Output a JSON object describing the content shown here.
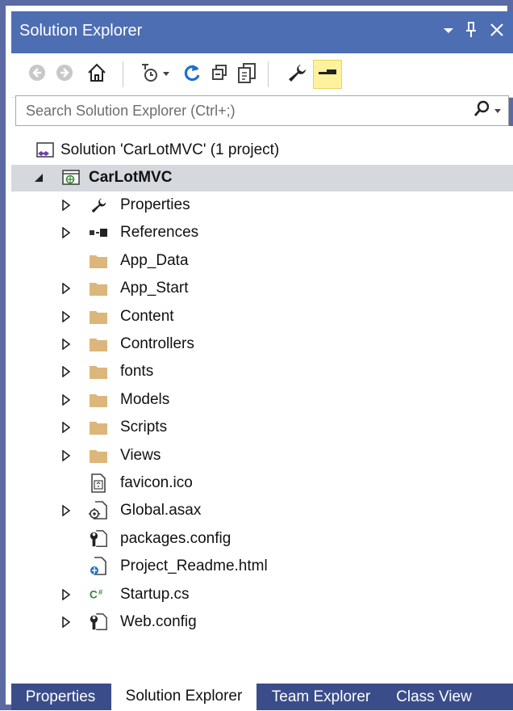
{
  "window": {
    "title": "Solution Explorer",
    "controls": [
      "chevron-down-icon",
      "pin-icon",
      "close-icon"
    ]
  },
  "toolbar": {
    "buttons": [
      "back-icon",
      "forward-icon",
      "home-icon",
      "pending-changes-filter-icon",
      "dropdown-arrow-icon",
      "refresh-icon",
      "collapse-all-icon",
      "show-all-files-icon",
      "properties-icon",
      "preview-selected-icon"
    ],
    "active": "preview-selected-icon"
  },
  "search": {
    "placeholder": "Search Solution Explorer (Ctrl+;)",
    "value": ""
  },
  "tree": {
    "solution": "Solution 'CarLotMVC' (1 project)",
    "project": "CarLotMVC",
    "items": [
      {
        "label": "Properties",
        "expandable": true,
        "icon": "wrench-icon"
      },
      {
        "label": "References",
        "expandable": true,
        "icon": "references-icon"
      },
      {
        "label": "App_Data",
        "expandable": false,
        "icon": "folder-icon"
      },
      {
        "label": "App_Start",
        "expandable": true,
        "icon": "folder-icon"
      },
      {
        "label": "Content",
        "expandable": true,
        "icon": "folder-icon"
      },
      {
        "label": "Controllers",
        "expandable": true,
        "icon": "folder-icon"
      },
      {
        "label": "fonts",
        "expandable": true,
        "icon": "folder-icon"
      },
      {
        "label": "Models",
        "expandable": true,
        "icon": "folder-icon"
      },
      {
        "label": "Scripts",
        "expandable": true,
        "icon": "folder-icon"
      },
      {
        "label": "Views",
        "expandable": true,
        "icon": "folder-icon"
      },
      {
        "label": "favicon.ico",
        "expandable": false,
        "icon": "image-file-icon"
      },
      {
        "label": "Global.asax",
        "expandable": true,
        "icon": "global-asax-file-icon"
      },
      {
        "label": "packages.config",
        "expandable": false,
        "icon": "config-file-icon"
      },
      {
        "label": "Project_Readme.html",
        "expandable": false,
        "icon": "html-file-icon"
      },
      {
        "label": "Startup.cs",
        "expandable": true,
        "icon": "csharp-file-icon"
      },
      {
        "label": "Web.config",
        "expandable": true,
        "icon": "config-file-icon"
      }
    ]
  },
  "tabs": [
    {
      "label": "Properties",
      "active": false
    },
    {
      "label": "Solution Explorer",
      "active": true
    },
    {
      "label": "Team Explorer",
      "active": false
    },
    {
      "label": "Class View",
      "active": false
    }
  ],
  "colors": {
    "titlebar": "#4d6eb3",
    "border": "#5b6aa3",
    "tabbar": "#3a4d8a",
    "selection": "#d5d8dc",
    "folder": "#dcb67a",
    "active_button": "#fff29d",
    "accent_blue": "#1e6fd1",
    "csharp_green": "#388a34"
  }
}
